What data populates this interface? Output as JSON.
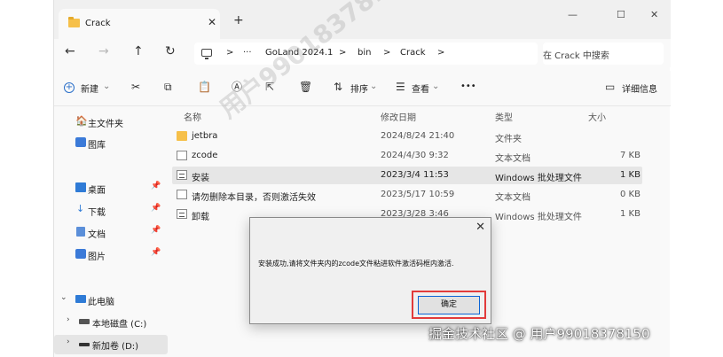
{
  "tab": {
    "title": "Crack",
    "close": "✕",
    "new": "+"
  },
  "window_controls": {
    "minimize": "—",
    "maximize": "☐",
    "close": "✕"
  },
  "nav": {
    "back": "←",
    "forward": "→",
    "up": "↑",
    "refresh": "↻"
  },
  "breadcrumb": {
    "sep": ">",
    "more": "···",
    "parts": [
      "GoLand 2024.1",
      "bin",
      "Crack"
    ]
  },
  "search": {
    "placeholder": "在 Crack 中搜索"
  },
  "commandbar": {
    "new_label": "新建",
    "sort_label": "排序",
    "view_label": "查看",
    "more": "•••",
    "details_label": "详细信息",
    "chevron": "⌄"
  },
  "sidebar": {
    "items": [
      {
        "label": "主文件夹",
        "icon": "home-icon"
      },
      {
        "label": "图库",
        "icon": "gallery-icon"
      },
      {
        "label": "桌面",
        "icon": "desktop-icon",
        "pinned": true
      },
      {
        "label": "下载",
        "icon": "download-icon",
        "pinned": true
      },
      {
        "label": "文档",
        "icon": "document-icon",
        "pinned": true
      },
      {
        "label": "图片",
        "icon": "pictures-icon",
        "pinned": true
      },
      {
        "label": "此电脑",
        "icon": "computer-icon"
      },
      {
        "label": "本地磁盘 (C:)",
        "icon": "drive-icon"
      },
      {
        "label": "新加卷 (D:)",
        "icon": "drive-icon"
      }
    ],
    "pin": "📌"
  },
  "columns": {
    "name": "名称",
    "modified": "修改日期",
    "type": "类型",
    "size": "大小"
  },
  "files": [
    {
      "name": "jetbra",
      "modified": "2024/8/24 21:40",
      "type": "文件夹",
      "size": "",
      "icon": "folder"
    },
    {
      "name": "zcode",
      "modified": "2024/4/30 9:32",
      "type": "文本文档",
      "size": "7 KB",
      "icon": "txt"
    },
    {
      "name": "安装",
      "modified": "2023/3/4 11:53",
      "type": "Windows 批处理文件",
      "size": "1 KB",
      "icon": "bat"
    },
    {
      "name": "请勿删除本目录，否则激活失效",
      "modified": "2023/5/17 10:59",
      "type": "文本文档",
      "size": "0 KB",
      "icon": "txt"
    },
    {
      "name": "卸载",
      "modified": "2023/3/28 3:46",
      "type": "Windows 批处理文件",
      "size": "1 KB",
      "icon": "bat"
    }
  ],
  "dialog": {
    "message": "安装成功,请将文件夹内的zcode文件粘进软件激活码框内激活.",
    "ok": "确定",
    "close": "✕"
  },
  "watermark": "用户99018378150",
  "footer_credit": "掘金技术社区 @ 用户99018378150"
}
